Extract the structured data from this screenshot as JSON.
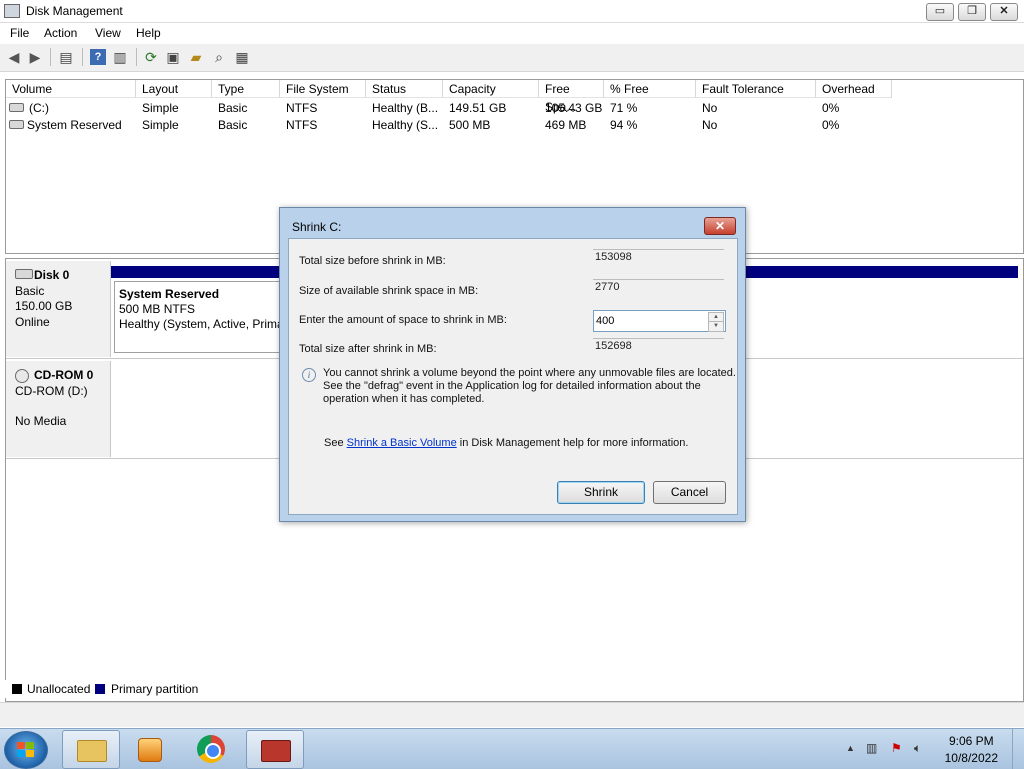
{
  "window": {
    "title": "Disk Management",
    "min_label": "▭",
    "restore_label": "❐",
    "close_label": "✕"
  },
  "menu": [
    "File",
    "Action",
    "View",
    "Help"
  ],
  "toolbar": {
    "icons": [
      "back-icon",
      "forward-icon",
      "properties-icon",
      "help-icon",
      "console-icon",
      "refresh-icon",
      "rescan-icon",
      "open-icon",
      "search-icon",
      "settings-icon"
    ]
  },
  "volumes": {
    "columns": [
      "Volume",
      "Layout",
      "Type",
      "File System",
      "Status",
      "Capacity",
      "Free Spa...",
      "% Free",
      "Fault Tolerance",
      "Overhead"
    ],
    "rows": [
      [
        "(C:)",
        "Simple",
        "Basic",
        "NTFS",
        "Healthy (B...",
        "149.51 GB",
        "105.43 GB",
        "71 %",
        "No",
        "0%"
      ],
      [
        "System Reserved",
        "Simple",
        "Basic",
        "NTFS",
        "Healthy (S...",
        "500 MB",
        "469 MB",
        "94 %",
        "No",
        "0%"
      ]
    ]
  },
  "disks": [
    {
      "name": "Disk 0",
      "type": "Basic",
      "size": "150.00 GB",
      "status": "Online"
    },
    {
      "name": "CD-ROM 0",
      "type": "CD-ROM (D:)",
      "status": "No Media"
    }
  ],
  "partition": {
    "name": "System Reserved",
    "size": "500 MB NTFS",
    "status": "Healthy (System, Active, Prima"
  },
  "legend": [
    "Unallocated",
    "Primary partition"
  ],
  "colors": {
    "unallocated": "#000000",
    "primary": "#00007f",
    "dialog_frame": "#b9d1ea",
    "link": "#0033cc"
  },
  "dialog": {
    "title": "Shrink C:",
    "close_label": "✕",
    "total_before_label": "Total size before shrink in MB:",
    "total_before_value": "153098",
    "available_label": "Size of available shrink space in MB:",
    "available_value": "2770",
    "enter_label": "Enter the amount of space to shrink in MB:",
    "enter_value": "400",
    "total_after_label": "Total size after shrink in MB:",
    "total_after_value": "152698",
    "info_icon": "i",
    "info_line1": "You cannot shrink a volume beyond the point where any unmovable files are located.",
    "info_line2": "See the \"defrag\" event in the Application log for detailed information about the",
    "info_line3": "operation when it has completed.",
    "see_prefix": "See",
    "see_link": "Shrink a Basic Volume",
    "see_suffix": "in Disk Management help for more information.",
    "shrink_button": "Shrink",
    "cancel_button": "Cancel"
  },
  "taskbar": {
    "time": "9:06 PM",
    "date": "10/8/2022",
    "tray_arrow": "▲"
  }
}
